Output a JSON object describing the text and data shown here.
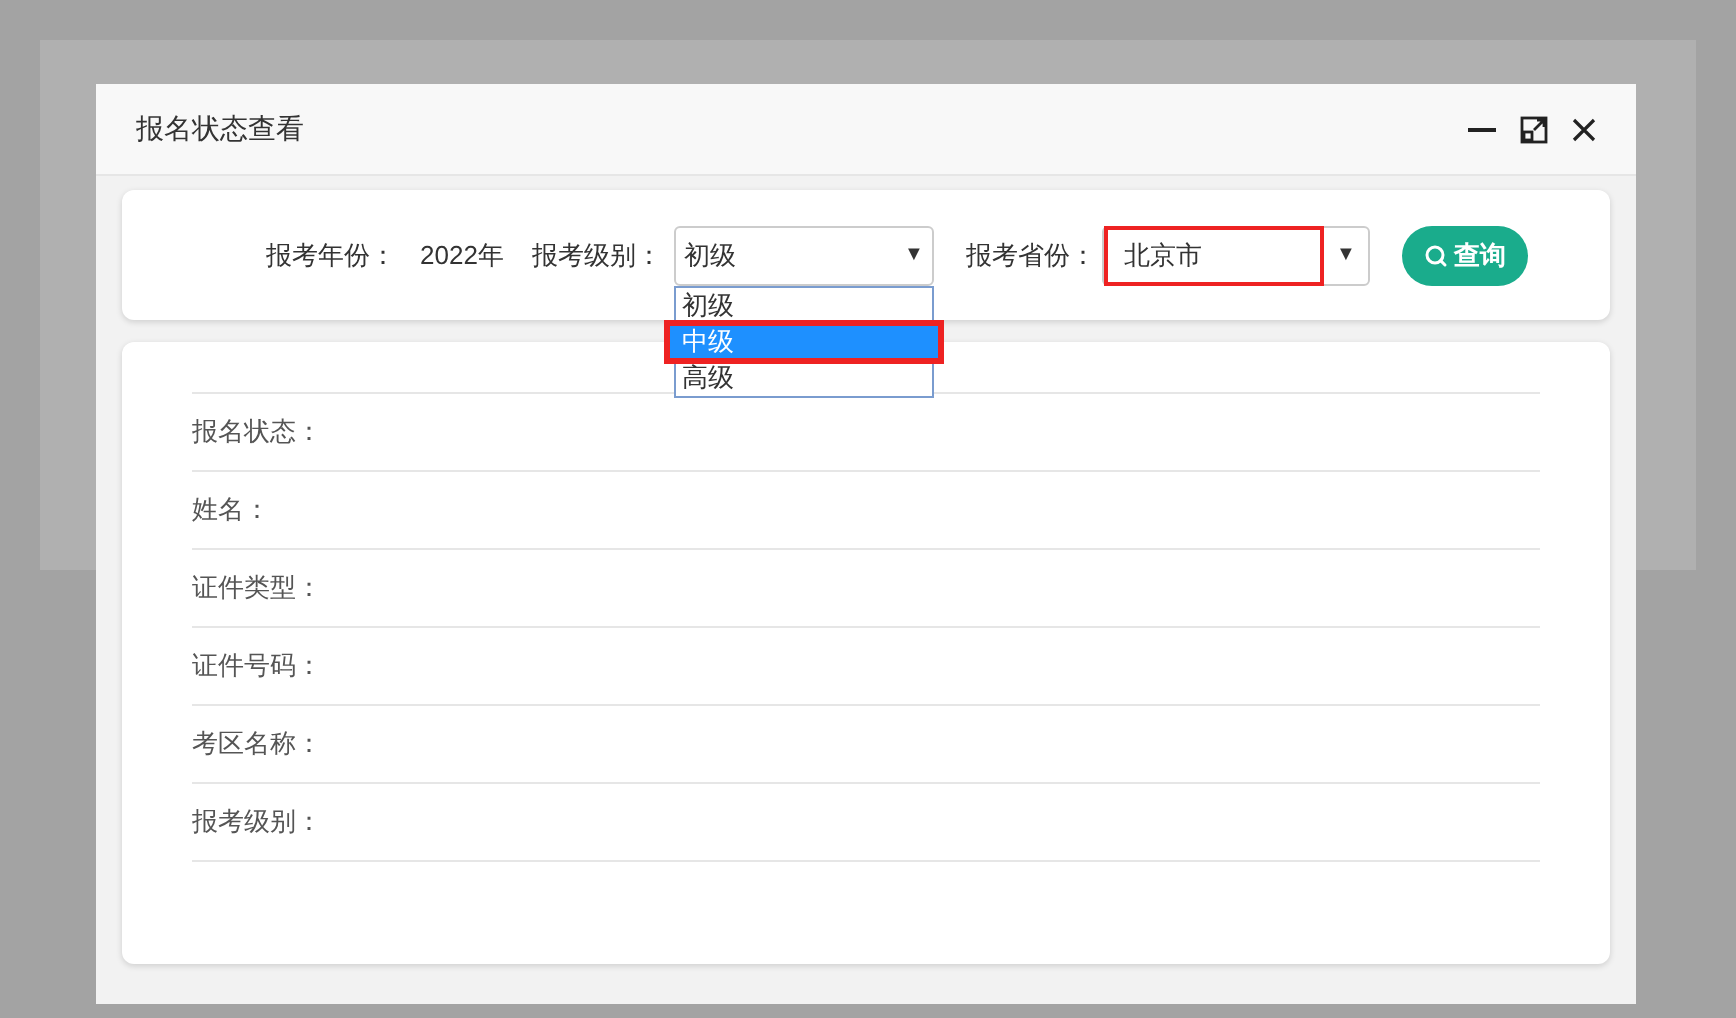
{
  "dialog": {
    "title": "报名状态查看"
  },
  "query": {
    "year_label": "报考年份：",
    "year_value": "2022年",
    "level": {
      "label": "报考级别：",
      "value": "初级",
      "arrow": "▼",
      "expanded": true,
      "options": [
        {
          "label": "初级",
          "hovered": false,
          "highlighted": false
        },
        {
          "label": "中级",
          "hovered": true,
          "highlighted": true
        },
        {
          "label": "高级",
          "hovered": false,
          "highlighted": false
        }
      ]
    },
    "province": {
      "label": "报考省份：",
      "value": "北京市",
      "arrow": "▼",
      "highlighted": true
    },
    "search_button": "查询"
  },
  "fields": [
    {
      "label": "报名状态："
    },
    {
      "label": "姓名："
    },
    {
      "label": "证件类型："
    },
    {
      "label": "证件号码："
    },
    {
      "label": "考区名称："
    },
    {
      "label": "报考级别："
    }
  ]
}
